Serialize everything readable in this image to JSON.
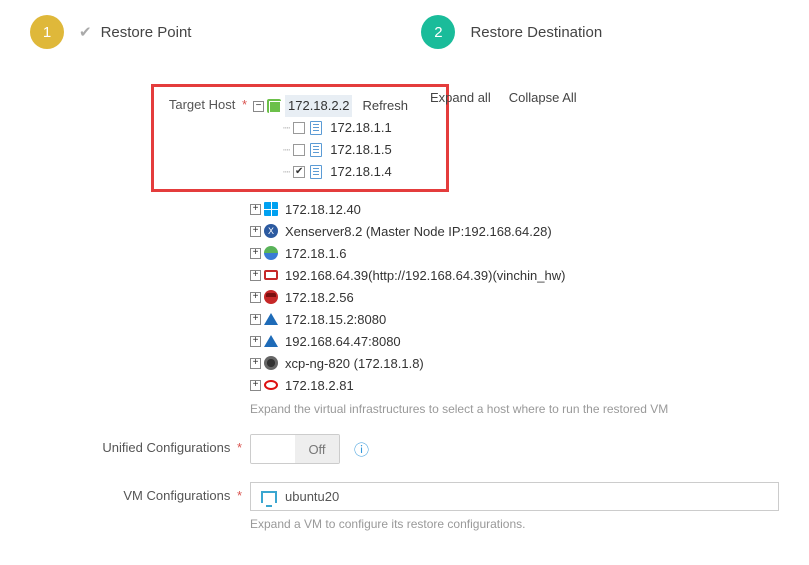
{
  "steps": {
    "s1_num": "1",
    "s1_label": "Restore Point",
    "s2_num": "2",
    "s2_label": "Restore Destination"
  },
  "labels": {
    "target_host": "Target Host",
    "unified_conf": "Unified Configurations",
    "vm_conf": "VM Configurations"
  },
  "tree": {
    "root_ip": "172.18.2.2",
    "actions": {
      "refresh": "Refresh",
      "expand": "Expand all",
      "collapse": "Collapse All"
    },
    "children": [
      {
        "ip": "172.18.1.1",
        "checked": false
      },
      {
        "ip": "172.18.1.5",
        "checked": false
      },
      {
        "ip": "172.18.1.4",
        "checked": true
      }
    ],
    "siblings": [
      {
        "icon": "win",
        "label": "172.18.12.40"
      },
      {
        "icon": "xen",
        "label": "Xenserver8.2 (Master Node IP:192.168.64.28)"
      },
      {
        "icon": "s3",
        "label": "172.18.1.6"
      },
      {
        "icon": "ovirt",
        "label": "192.168.64.39(http://192.168.64.39)(vinchin_hw)"
      },
      {
        "icon": "redhat",
        "label": "172.18.2.56"
      },
      {
        "icon": "azure",
        "label": "172.18.15.2:8080"
      },
      {
        "icon": "azure",
        "label": "192.168.64.47:8080"
      },
      {
        "icon": "xcp",
        "label": "xcp-ng-820 (172.18.1.8)"
      },
      {
        "icon": "redoval",
        "label": "172.18.2.81"
      }
    ],
    "hint": "Expand the virtual infrastructures to select a host where to run the restored VM"
  },
  "toggle": {
    "off_label": "Off"
  },
  "vm": {
    "name": "ubuntu20"
  },
  "vm_hint": "Expand a VM to configure its restore configurations."
}
